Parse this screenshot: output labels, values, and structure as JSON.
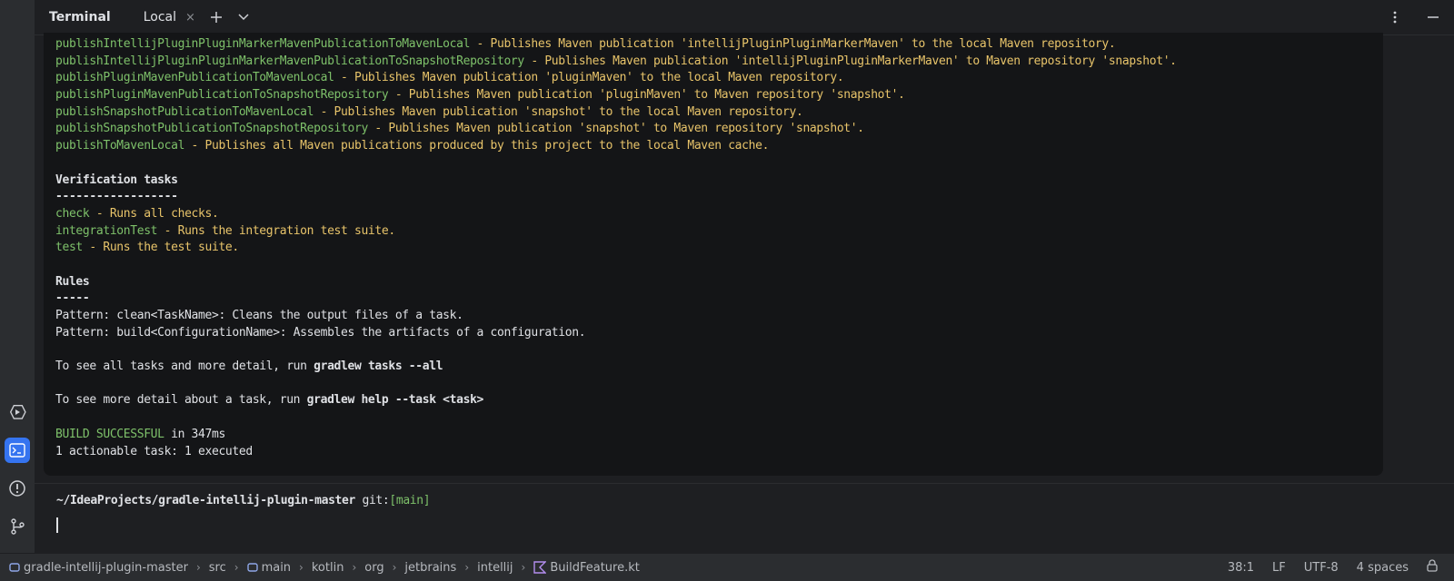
{
  "terminal": {
    "title": "Terminal",
    "tab_label": "Local",
    "close_glyph": "×",
    "add_glyph": "+",
    "chevron_glyph": "⌄",
    "more_glyph": "⋮",
    "minimize_glyph": "—"
  },
  "output_lines": [
    {
      "cmd": "publishIntellijPluginPluginMarkerMavenPublicationToMavenLocal",
      "desc": " - Publishes Maven publication 'intellijPluginPluginMarkerMaven' to the local Maven repository."
    },
    {
      "cmd": "publishIntellijPluginPluginMarkerMavenPublicationToSnapshotRepository",
      "desc": " - Publishes Maven publication 'intellijPluginPluginMarkerMaven' to Maven repository 'snapshot'."
    },
    {
      "cmd": "publishPluginMavenPublicationToMavenLocal",
      "desc": " - Publishes Maven publication 'pluginMaven' to the local Maven repository."
    },
    {
      "cmd": "publishPluginMavenPublicationToSnapshotRepository",
      "desc": " - Publishes Maven publication 'pluginMaven' to Maven repository 'snapshot'."
    },
    {
      "cmd": "publishSnapshotPublicationToMavenLocal",
      "desc": " - Publishes Maven publication 'snapshot' to the local Maven repository."
    },
    {
      "cmd": "publishSnapshotPublicationToSnapshotRepository",
      "desc": " - Publishes Maven publication 'snapshot' to Maven repository 'snapshot'."
    },
    {
      "cmd": "publishToMavenLocal",
      "desc": " - Publishes all Maven publications produced by this project to the local Maven cache."
    },
    {
      "text": ""
    },
    {
      "text": "Verification tasks",
      "style": "heading"
    },
    {
      "text": "------------------",
      "style": "heading"
    },
    {
      "cmd": "check",
      "desc": " - Runs all checks."
    },
    {
      "cmd": "integrationTest",
      "desc": " - Runs the integration test suite."
    },
    {
      "cmd": "test",
      "desc": " - Runs the test suite."
    },
    {
      "text": ""
    },
    {
      "text": "Rules",
      "style": "heading"
    },
    {
      "text": "-----",
      "style": "heading"
    },
    {
      "text": "Pattern: clean<TaskName>: Cleans the output files of a task."
    },
    {
      "text": "Pattern: build<ConfigurationName>: Assembles the artifacts of a configuration."
    },
    {
      "text": ""
    },
    {
      "text": "To see all tasks and more detail, run ",
      "bold": "gradlew tasks --all"
    },
    {
      "text": ""
    },
    {
      "text": "To see more detail about a task, run ",
      "bold": "gradlew help --task <task>"
    },
    {
      "text": ""
    },
    {
      "success": "BUILD SUCCESSFUL",
      "text": " in 347ms"
    },
    {
      "text": "1 actionable task: 1 executed"
    }
  ],
  "prompt": {
    "path": "~/IdeaProjects/gradle-intellij-plugin-master",
    "git_label": " git:",
    "branch": "[main]"
  },
  "breadcrumb": [
    {
      "label": "gradle-intellij-plugin-master",
      "icon": "module-icon"
    },
    {
      "label": "src"
    },
    {
      "label": "main",
      "icon": "folder-icon"
    },
    {
      "label": "kotlin"
    },
    {
      "label": "org"
    },
    {
      "label": "jetbrains"
    },
    {
      "label": "intellij"
    },
    {
      "label": "BuildFeature.kt",
      "icon": "kotlin-file-icon"
    }
  ],
  "status": {
    "position": "38:1",
    "line_ending": "LF",
    "encoding": "UTF-8",
    "indent": "4 spaces"
  },
  "colors": {
    "accent": "#3574f0",
    "task_name": "#7ec16a",
    "task_desc": "#e8c46a",
    "branch": "#7ec16a"
  }
}
